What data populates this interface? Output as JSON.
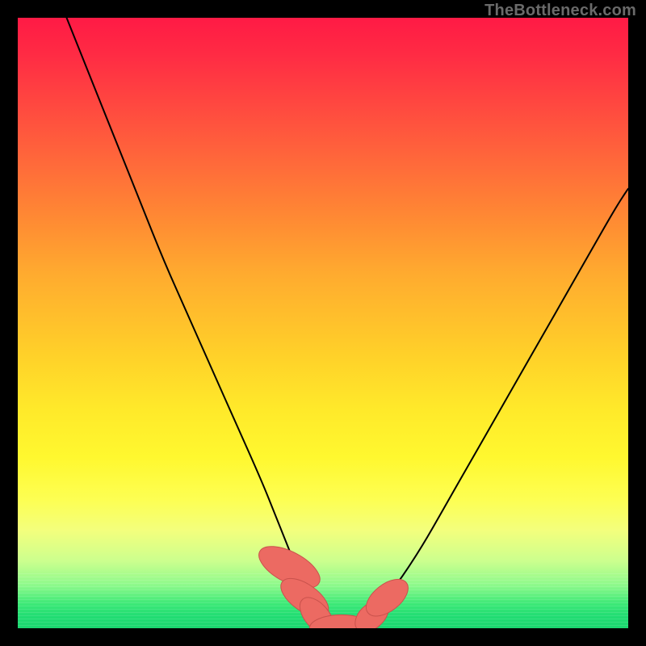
{
  "watermark": "TheBottleneck.com",
  "chart_data": {
    "type": "line",
    "title": "",
    "xlabel": "",
    "ylabel": "",
    "xlim": [
      0,
      100
    ],
    "ylim": [
      0,
      100
    ],
    "series": [
      {
        "name": "bottleneck-curve",
        "x": [
          8,
          12,
          16,
          20,
          24,
          28,
          32,
          36,
          40,
          42,
          44,
          46,
          48,
          50,
          52,
          54,
          56,
          58,
          62,
          66,
          70,
          74,
          78,
          82,
          86,
          90,
          94,
          98,
          100
        ],
        "y": [
          100,
          90,
          80,
          70,
          60,
          51,
          42,
          33,
          24,
          19,
          14,
          9,
          5,
          2,
          0,
          0,
          0,
          2,
          7,
          13,
          20,
          27,
          34,
          41,
          48,
          55,
          62,
          69,
          72
        ]
      }
    ],
    "markers": [
      {
        "name": "left-marker-1",
        "x": 44.5,
        "y": 10,
        "rx": 2.5,
        "ry": 5.5,
        "angle": -62
      },
      {
        "name": "left-marker-2",
        "x": 47.0,
        "y": 5,
        "rx": 2.2,
        "ry": 4.5,
        "angle": -55
      },
      {
        "name": "left-marker-3",
        "x": 49.0,
        "y": 2,
        "rx": 2.0,
        "ry": 3.6,
        "angle": -40
      },
      {
        "name": "bottom-marker",
        "x": 53.0,
        "y": 0,
        "rx": 2.2,
        "ry": 5.2,
        "angle": 90
      },
      {
        "name": "right-marker-1",
        "x": 58.0,
        "y": 2,
        "rx": 2.0,
        "ry": 3.2,
        "angle": 48
      },
      {
        "name": "right-marker-2",
        "x": 60.5,
        "y": 5,
        "rx": 2.2,
        "ry": 4.0,
        "angle": 52
      }
    ],
    "colors": {
      "curve": "#000000",
      "marker_fill": "#ec6a62",
      "marker_stroke": "#c9524c"
    }
  }
}
